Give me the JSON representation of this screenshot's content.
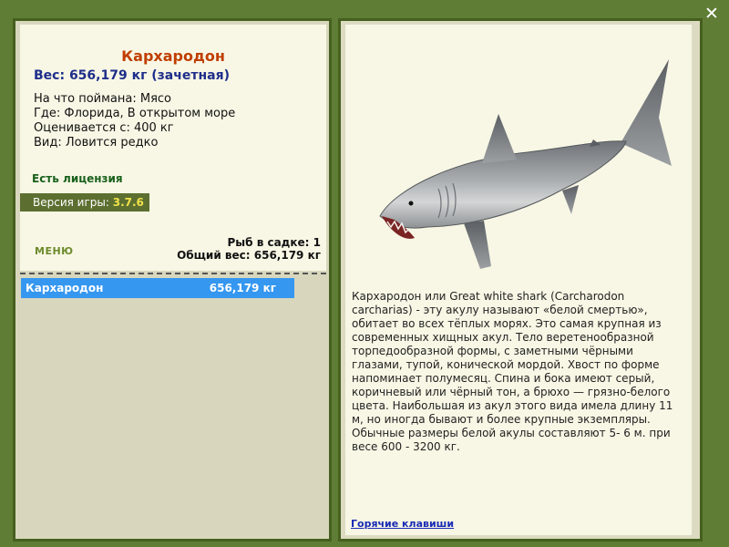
{
  "colors": {
    "background": "#5f7d35",
    "panel": "#f8f7e5",
    "title": "#c03e00",
    "weight": "#1e2e8a",
    "license": "#19611c",
    "selected_row": "#3597f0",
    "link": "#1a2bb5"
  },
  "close_icon": "close-icon",
  "fish_card": {
    "name": "Кархародон",
    "weight_line": "Вес: 656,179 кг (зачетная)",
    "caught_on": "На что поймана: Мясо",
    "caught_where": "Где: Флорида, В открытом море",
    "valued_from": "Оценивается с: 400 кг",
    "species": "Вид: Ловится редко",
    "license": "Есть лицензия",
    "version_label": "Версия игры:",
    "version_value": "3.7.6",
    "menu_label": "МЕНЮ",
    "fish_in_cage": "Рыб в садке: 1",
    "total_weight": "Общий вес: 656,179 кг"
  },
  "catch_list": [
    {
      "name": "Кархародон",
      "weight": "656,179 кг"
    }
  ],
  "detail": {
    "image": "great-white-shark",
    "description": "Кархародон или Great white shark (Carcharodon carcharias) - эту акулу называют «белой смертью», обитает во всех тёплых морях. Это самая крупная из современных хищных акул. Тело веретенообразной торпедообразной формы, с заметными чёрными глазами, тупой, конической мордой. Хвост по форме напоминает полумесяц. Спина и бока имеют серый, коричневый или чёрный тон, а брюхо — грязно-белого цвета. Наибольшая из акул этого вида имела длину 11 м, но иногда бывают и более крупные экземпляры. Обычные размеры белой акулы составляют 5- 6 м. при весе 600 - 3200 кг.",
    "hotkeys_link": "Горячие клавиши"
  }
}
